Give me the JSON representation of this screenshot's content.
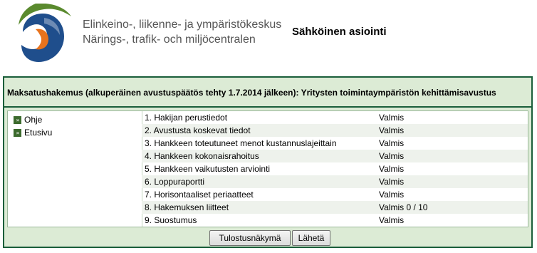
{
  "header": {
    "org_fi": "Elinkeino-, liikenne- ja ympäristökeskus",
    "org_sv": "Närings-, trafik- och miljöcentralen",
    "service_title": "Sähköinen asiointi"
  },
  "panel": {
    "title": "Maksatushakemus (alkuperäinen avustuspäätös tehty 1.7.2014 jälkeen): Yritysten toimintaympäristön kehittämisavustus"
  },
  "sidenav": {
    "items": [
      {
        "label": "Ohje",
        "icon": "double-chevron-right-icon"
      },
      {
        "label": "Etusivu",
        "icon": "double-chevron-right-icon"
      }
    ]
  },
  "sections": [
    {
      "name": "1. Hakijan perustiedot",
      "status": "Valmis"
    },
    {
      "name": "2. Avustusta koskevat tiedot",
      "status": "Valmis"
    },
    {
      "name": "3. Hankkeen toteutuneet menot kustannuslajeittain",
      "status": "Valmis"
    },
    {
      "name": "4. Hankkeen kokonaisrahoitus",
      "status": "Valmis"
    },
    {
      "name": "5. Hankkeen vaikutusten arviointi",
      "status": "Valmis"
    },
    {
      "name": "6. Loppuraportti",
      "status": "Valmis"
    },
    {
      "name": "7. Horisontaaliset periaatteet",
      "status": "Valmis"
    },
    {
      "name": "8. Hakemuksen liitteet",
      "status": "Valmis 0 / 10"
    },
    {
      "name": "9. Suostumus",
      "status": "Valmis"
    }
  ],
  "buttons": {
    "print": "Tulostusnäkymä",
    "send": "Lähetä"
  },
  "colors": {
    "panel_border": "#1a5e3a",
    "panel_bg": "#dcebd5",
    "row_alt": "#eef2ec",
    "logo_blue": "#1f4e8c",
    "logo_orange": "#e8731d",
    "logo_green": "#5a8a2e"
  }
}
